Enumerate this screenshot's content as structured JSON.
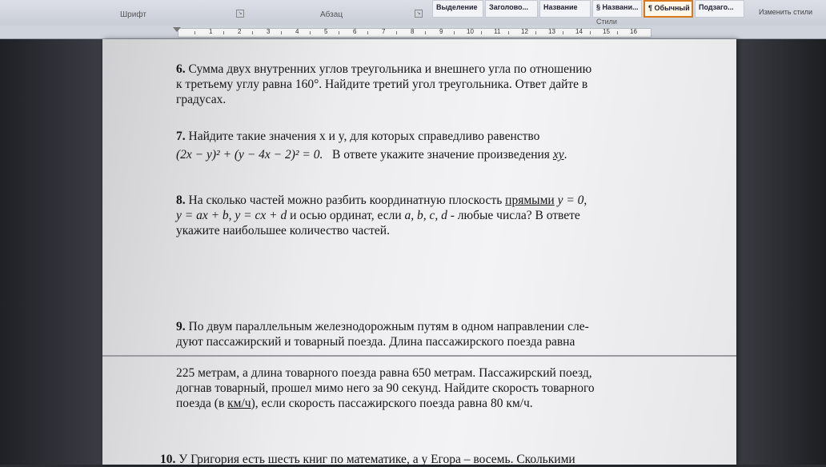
{
  "ribbon": {
    "font_group": "Шрифт",
    "paragraph_group": "Абзац",
    "styles_group": "Стили",
    "styles": [
      "Выделение",
      "Заголово...",
      "Название",
      "§ Названи...",
      "¶ Обычный",
      "Подзаго..."
    ],
    "change_styles": "Изменить стили"
  },
  "ruler": {
    "numbers": [
      "1",
      "2",
      "3",
      "4",
      "5",
      "6",
      "7",
      "8",
      "9",
      "10",
      "11",
      "12",
      "13",
      "14",
      "15",
      "16"
    ]
  },
  "document": {
    "q6": {
      "num": "6.",
      "line1": "Сумма двух внутренних углов треугольника и внешнего угла по отношению",
      "line2": "к третьему углу равна 160°. Найдите третий угол треугольника. Ответ дайте в",
      "line3": "градусах."
    },
    "q7": {
      "num": "7.",
      "line1": "Найдите такие значения  x  и  y,  для которых справедливо равенство",
      "formula": "(2x − y)² + (y − 4x − 2)² = 0.",
      "tail_text": "В ответе укажите значение  произведения",
      "tail_var": "xy",
      "tail_end": "."
    },
    "q8": {
      "num": "8.",
      "line1_text": "На сколько частей можно разбить координатную плоскость",
      "line1_link": "прямыми",
      "line1_math": "y = 0,",
      "line2_math": "y = ax + b,  y = cx + d",
      "line2_text": "и осью ординат, если",
      "line2_vars": "a, b, c, d",
      "line2_end": "- любые числа? В ответе",
      "line3": "укажите наибольшее количество частей."
    },
    "q9": {
      "num": "9.",
      "line1": "По двум параллельным железнодорожным путям в одном направлении сле-",
      "line2": "дуют пассажирский и товарный поезда. Длина пассажирского поезда равна",
      "line3": "225 метрам, а длина товарного поезда равна 650 метрам. Пассажирский поезд,",
      "line4": "догнав товарный, прошел мимо него за 90 секунд. Найдите скорость товарного",
      "line5_a": "поезда (в ",
      "line5_u": "км/ч",
      "line5_b": "), если скорость пассажирского поезда равна 80 км/ч."
    },
    "q10": {
      "num": "10.",
      "line1": "У Григория есть шесть книг по математике, а у Егора – восемь. Сколькими"
    }
  }
}
